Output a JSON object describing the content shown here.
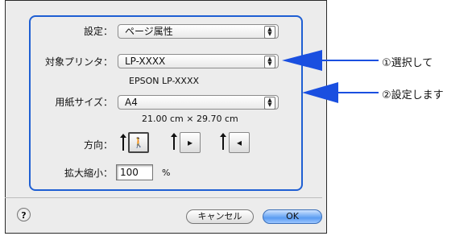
{
  "dialog": {
    "setting_label": "設定：",
    "setting_value": "ページ属性",
    "target_printer_label": "対象プリンタ：",
    "target_printer_value": "LP-XXXX",
    "printer_model": "EPSON LP-XXXX",
    "paper_size_label": "用紙サイズ：",
    "paper_size_value": "A4",
    "paper_dimensions": "21.00 cm × 29.70 cm",
    "orientation_label": "方向：",
    "scale_label": "拡大縮小：",
    "scale_value": "100",
    "scale_unit": "%",
    "help_label": "?",
    "cancel_label": "キャンセル",
    "ok_label": "OK"
  },
  "annotations": {
    "step1": "①選択して",
    "step2": "②設定します"
  },
  "colors": {
    "highlight": "#1f5fd3",
    "arrow": "#1a4fe0"
  },
  "icons": {
    "orientation_portrait": "portrait-orientation-icon",
    "orientation_landscape_left": "landscape-left-icon",
    "orientation_landscape_right": "landscape-right-icon"
  }
}
